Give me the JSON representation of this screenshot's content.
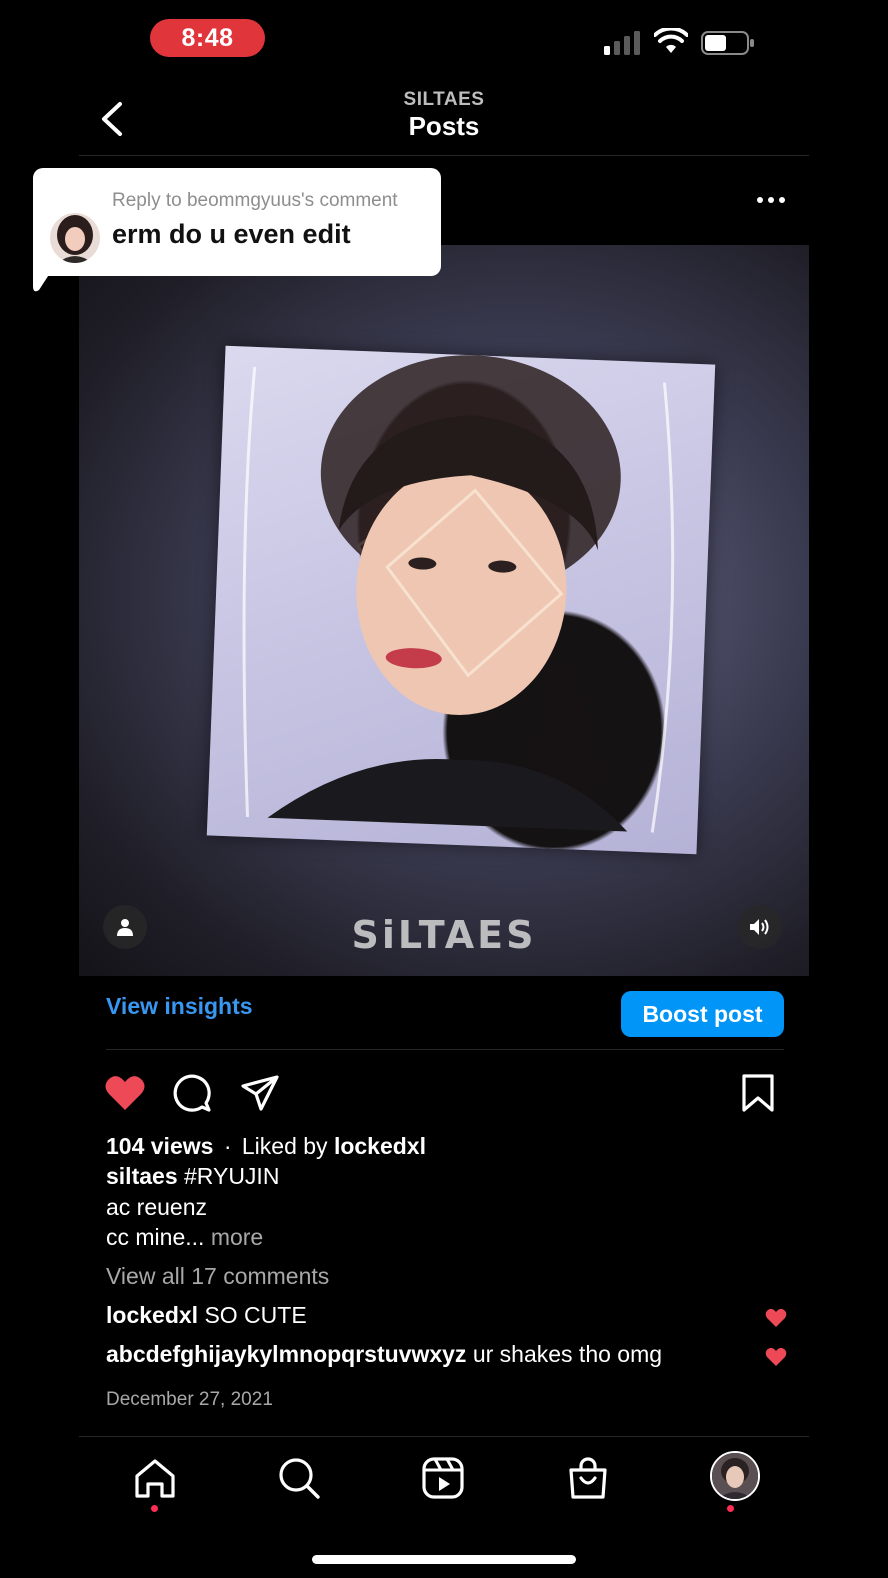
{
  "status": {
    "time": "8:48"
  },
  "header": {
    "account": "SILTAES",
    "title": "Posts"
  },
  "reply": {
    "context": "Reply to beommgyuus's comment",
    "text": "erm do u even edit"
  },
  "media": {
    "watermark": "SiLTAES"
  },
  "actions_row": {
    "insights": "View insights",
    "boost": "Boost post"
  },
  "post": {
    "views": "104 views",
    "sep": "·",
    "liked_by_prefix": "Liked by",
    "liked_by_user": "lockedxl",
    "caption_user": "siltaes",
    "caption_tag": "#RYUJIN",
    "caption_line2": "ac reuenz",
    "caption_line3": "cc mine...",
    "more": "more",
    "view_all": "View all 17 comments",
    "comments": [
      {
        "user": "lockedxl",
        "text": "SO CUTE"
      },
      {
        "user": "abcdefghijaykylmnopqrstuvwxyz",
        "text": "ur shakes tho omg"
      }
    ],
    "date": "December 27, 2021"
  },
  "colors": {
    "accent": "#0095f6",
    "link": "#3897f0",
    "like": "#ed4956",
    "time_pill": "#e0353b"
  },
  "icons": [
    "back-icon",
    "more-icon",
    "heart-icon",
    "comment-icon",
    "share-icon",
    "bookmark-icon",
    "home-icon",
    "search-icon",
    "reels-icon",
    "shop-icon",
    "profile-avatar"
  ]
}
